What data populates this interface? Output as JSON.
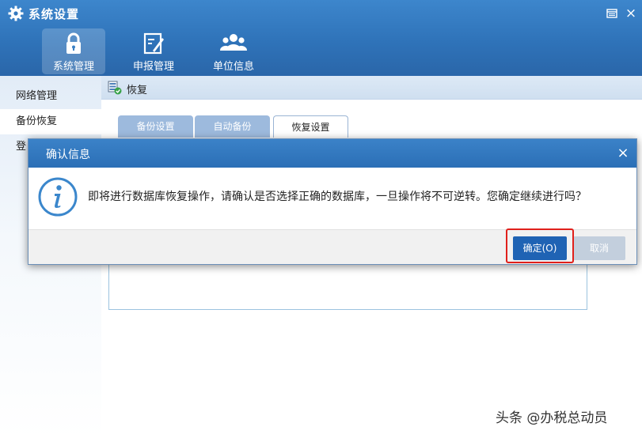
{
  "app": {
    "title": "系统设置",
    "icon": "gear-icon",
    "window_controls": [
      "restore-icon",
      "close-icon"
    ]
  },
  "nav": {
    "tabs": [
      {
        "label": "系统管理",
        "icon": "lock-icon",
        "active": true
      },
      {
        "label": "申报管理",
        "icon": "edit-document-icon",
        "active": false
      },
      {
        "label": "单位信息",
        "icon": "users-icon",
        "active": false
      }
    ]
  },
  "sidebar": {
    "items": [
      {
        "label": "网络管理"
      },
      {
        "label": "备份恢复",
        "selected": true
      },
      {
        "label": "登"
      }
    ]
  },
  "breadcrumb": {
    "label": "恢复",
    "icon": "restore-db-icon"
  },
  "subtabs": [
    {
      "label": "备份设置",
      "active": false
    },
    {
      "label": "自动备份",
      "active": false
    },
    {
      "label": "恢复设置",
      "active": true
    }
  ],
  "dialog": {
    "title": "确认信息",
    "message": "即将进行数据库恢复操作，请确认是否选择正确的数据库，一旦操作将不可逆转。您确定继续进行吗？",
    "icon": "info-icon",
    "ok_label": "确定(O)",
    "cancel_label": "取消"
  },
  "watermark": "头条 @办税总动员",
  "colors": {
    "header_blue": "#2f73b9",
    "ok_button": "#1f63b4",
    "highlight_red": "#e0201b"
  }
}
